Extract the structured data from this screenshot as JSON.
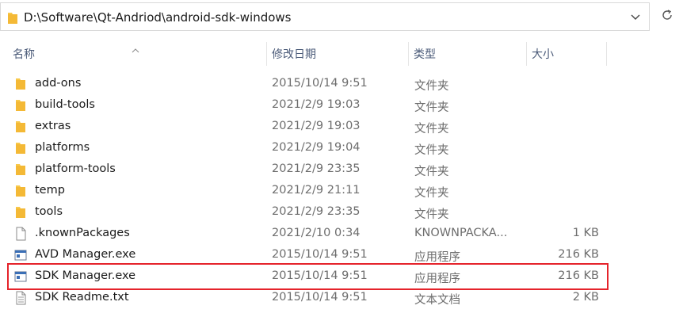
{
  "address_bar": {
    "path": "D:\\Software\\Qt-Andriod\\android-sdk-windows"
  },
  "columns": {
    "name": "名称",
    "date": "修改日期",
    "type": "类型",
    "size": "大小"
  },
  "files": [
    {
      "name": "add-ons",
      "date": "2015/10/14 9:51",
      "type": "文件夹",
      "size": "",
      "icon": "folder-icon"
    },
    {
      "name": "build-tools",
      "date": "2021/2/9 19:03",
      "type": "文件夹",
      "size": "",
      "icon": "folder-icon"
    },
    {
      "name": "extras",
      "date": "2021/2/9 19:03",
      "type": "文件夹",
      "size": "",
      "icon": "folder-icon"
    },
    {
      "name": "platforms",
      "date": "2021/2/9 19:04",
      "type": "文件夹",
      "size": "",
      "icon": "folder-icon"
    },
    {
      "name": "platform-tools",
      "date": "2021/2/9 23:35",
      "type": "文件夹",
      "size": "",
      "icon": "folder-icon"
    },
    {
      "name": "temp",
      "date": "2021/2/9 21:11",
      "type": "文件夹",
      "size": "",
      "icon": "folder-icon"
    },
    {
      "name": "tools",
      "date": "2021/2/9 23:35",
      "type": "文件夹",
      "size": "",
      "icon": "folder-icon"
    },
    {
      "name": ".knownPackages",
      "date": "2021/2/10 0:34",
      "type": "KNOWNPACKA...",
      "size": "1 KB",
      "icon": "file-icon"
    },
    {
      "name": "AVD Manager.exe",
      "date": "2015/10/14 9:51",
      "type": "应用程序",
      "size": "216 KB",
      "icon": "exe-icon"
    },
    {
      "name": "SDK Manager.exe",
      "date": "2015/10/14 9:51",
      "type": "应用程序",
      "size": "216 KB",
      "icon": "exe-icon"
    },
    {
      "name": "SDK Readme.txt",
      "date": "2015/10/14 9:51",
      "type": "文本文档",
      "size": "2 KB",
      "icon": "text-file-icon"
    }
  ],
  "colors": {
    "highlight": "#e5232b",
    "folder": "#f8c94b",
    "header_text": "#4a5a78"
  }
}
